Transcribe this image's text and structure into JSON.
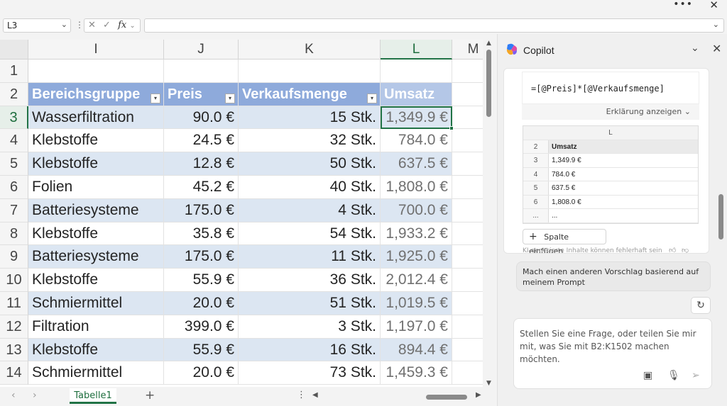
{
  "topbar": {
    "more_icon": "more-icon",
    "close_icon": "close-icon"
  },
  "formula_bar": {
    "name_box": "L3",
    "cancel_glyph": "✕",
    "confirm_glyph": "✓",
    "fx_label": "fx",
    "formula": ""
  },
  "columns": [
    "I",
    "J",
    "K",
    "L",
    "M"
  ],
  "selected_column": "L",
  "rows": [
    "1",
    "2",
    "3",
    "4",
    "5",
    "6",
    "7",
    "8",
    "9",
    "10",
    "11",
    "12",
    "13",
    "14"
  ],
  "selected_row": "3",
  "table": {
    "headers": [
      "Bereichsgruppe",
      "Preis",
      "Verkaufsmenge",
      "Umsatz"
    ],
    "data": [
      [
        "Wasserfiltration",
        "90.0 €",
        "15 Stk.",
        "1,349.9 €"
      ],
      [
        "Klebstoffe",
        "24.5 €",
        "32 Stk.",
        "784.0 €"
      ],
      [
        "Klebstoffe",
        "12.8 €",
        "50 Stk.",
        "637.5 €"
      ],
      [
        "Folien",
        "45.2 €",
        "40 Stk.",
        "1,808.0 €"
      ],
      [
        "Batteriesysteme",
        "175.0 €",
        "4 Stk.",
        "700.0 €"
      ],
      [
        "Klebstoffe",
        "35.8 €",
        "54 Stk.",
        "1,933.2 €"
      ],
      [
        "Batteriesysteme",
        "175.0 €",
        "11 Stk.",
        "1,925.0 €"
      ],
      [
        "Klebstoffe",
        "55.9 €",
        "36 Stk.",
        "2,012.4 €"
      ],
      [
        "Schmiermittel",
        "20.0 €",
        "51 Stk.",
        "1,019.5 €"
      ],
      [
        "Filtration",
        "399.0 €",
        "3 Stk.",
        "1,197.0 €"
      ],
      [
        "Klebstoffe",
        "55.9 €",
        "16 Stk.",
        "894.4 €"
      ],
      [
        "Schmiermittel",
        "20.0 €",
        "73 Stk.",
        "1,459.3 €"
      ]
    ]
  },
  "sheets": {
    "active": "Tabelle1",
    "add": "+"
  },
  "copilot": {
    "title": "Copilot",
    "formula": "=[@Preis]*[@Verkaufsmenge]",
    "explain_label": "Erklärung anzeigen",
    "preview": {
      "column": "L",
      "rows": [
        {
          "n": "2",
          "v": "Umsatz"
        },
        {
          "n": "3",
          "v": "1,349.9 €"
        },
        {
          "n": "4",
          "v": "784.0 €"
        },
        {
          "n": "5",
          "v": "637.5 €"
        },
        {
          "n": "6",
          "v": "1,808.0 €"
        },
        {
          "n": "...",
          "v": "..."
        }
      ]
    },
    "insert_column": "Spalte einfügen",
    "disclaimer": "KI-generierte Inhalte können fehlerhaft sein",
    "suggestion": "Mach einen anderen Vorschlag basierend auf meinem Prompt",
    "prompt_placeholder": "Stellen Sie eine Frage, oder teilen Sie mir mit, was Sie mit B2:K1502 machen möchten."
  }
}
